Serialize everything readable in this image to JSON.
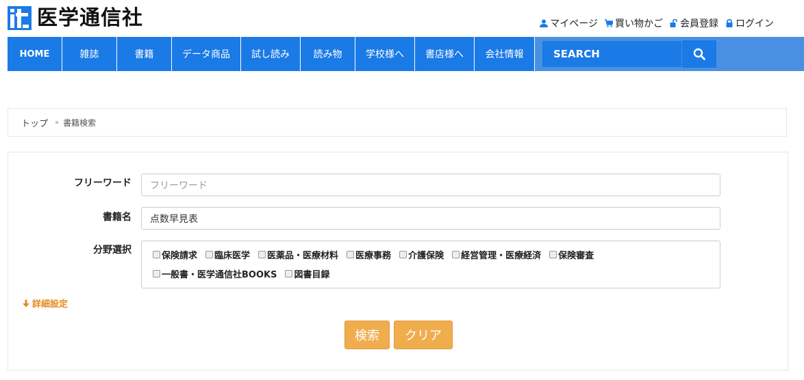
{
  "header": {
    "logo_text": "医学通信社",
    "links": [
      {
        "label": "マイページ",
        "icon": "user-icon"
      },
      {
        "label": "買い物かご",
        "icon": "cart-icon"
      },
      {
        "label": "会員登録",
        "icon": "unlock-icon"
      },
      {
        "label": "ログイン",
        "icon": "lock-icon"
      }
    ]
  },
  "nav": {
    "items": [
      "HOME",
      "雑誌",
      "書籍",
      "データ商品",
      "試し読み",
      "読み物",
      "学校様へ",
      "書店様へ",
      "会社情報"
    ],
    "search_placeholder": "SEARCH"
  },
  "breadcrumb": {
    "home": "トップ",
    "separator": "»",
    "current": "書籍検索"
  },
  "form": {
    "freeword_label": "フリーワード",
    "freeword_placeholder": "フリーワード",
    "title_label": "書籍名",
    "title_value": "点数早見表",
    "category_label": "分野選択",
    "categories_row1": [
      "保険請求",
      "臨床医学",
      "医薬品・医療材料",
      "医療事務",
      "介護保険",
      "経営管理・医療経済",
      "保険審査"
    ],
    "categories_row2": [
      "一般書・医学通信社BOOKS",
      "図書目録"
    ],
    "detail_label": "詳細設定",
    "search_button": "検索",
    "clear_button": "クリア"
  },
  "colors": {
    "nav_blue": "#1a7ae6",
    "accent_orange": "#f0ad4e",
    "detail_orange": "#e8891f"
  }
}
